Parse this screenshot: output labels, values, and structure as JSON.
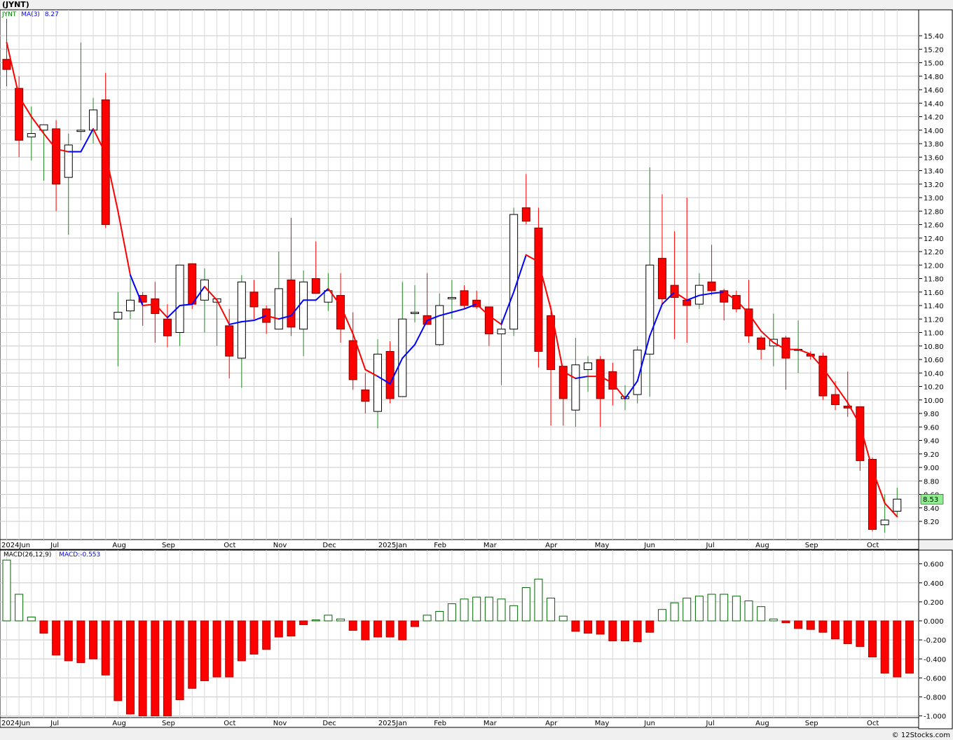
{
  "title": "(JYNT)",
  "credit": "© 12Stocks.com",
  "price_legend": {
    "symbol": "JYNT",
    "ma_label": "MA(3)",
    "ma_value": "8.27"
  },
  "macd_legend": {
    "label": "MACD(26,12,9)",
    "value_label": "MACD:-0.553"
  },
  "last_price_label": "8.53",
  "colors": {
    "bear": "#ff0000",
    "bull_fill": "#ffffff",
    "bull_wick": "#228b22",
    "ma_down": "#ff0000",
    "ma_up": "#0000ff",
    "macd_pos": "#006400",
    "macd_neg": "#ff0000",
    "last_price_bg": "#90ee90"
  },
  "chart_data": [
    {
      "type": "candlestick",
      "interval": "weekly",
      "ylim": [
        8.0,
        15.6
      ],
      "yticks": [
        "15.40",
        "15.20",
        "15.00",
        "14.80",
        "14.60",
        "14.40",
        "14.20",
        "14.00",
        "13.80",
        "13.60",
        "13.40",
        "13.20",
        "13.00",
        "12.80",
        "12.60",
        "12.40",
        "12.20",
        "12.00",
        "11.80",
        "11.60",
        "11.40",
        "11.20",
        "11.00",
        "10.80",
        "10.60",
        "10.40",
        "10.20",
        "10.00",
        "9.80",
        "9.60",
        "9.40",
        "9.20",
        "9.00",
        "8.80",
        "8.60",
        "8.40",
        "8.20"
      ],
      "month_labels": [
        {
          "label": "2024Jun",
          "week": 0
        },
        {
          "label": "Jul",
          "week": 4
        },
        {
          "label": "Aug",
          "week": 9
        },
        {
          "label": "Sep",
          "week": 13
        },
        {
          "label": "Oct",
          "week": 18
        },
        {
          "label": "Nov",
          "week": 22
        },
        {
          "label": "Dec",
          "week": 26
        },
        {
          "label": "2025Jan",
          "week": 30.5
        },
        {
          "label": "Feb",
          "week": 35
        },
        {
          "label": "Mar",
          "week": 39
        },
        {
          "label": "Apr",
          "week": 44
        },
        {
          "label": "May",
          "week": 48
        },
        {
          "label": "Jun",
          "week": 52
        },
        {
          "label": "Jul",
          "week": 57
        },
        {
          "label": "Aug",
          "week": 61
        },
        {
          "label": "Sep",
          "week": 65
        },
        {
          "label": "Oct",
          "week": 70
        }
      ],
      "ohlc": [
        [
          15.05,
          15.65,
          14.65,
          14.9
        ],
        [
          14.62,
          14.8,
          13.6,
          13.85
        ],
        [
          13.9,
          14.35,
          13.55,
          13.95
        ],
        [
          14.0,
          14.05,
          13.25,
          14.08
        ],
        [
          14.02,
          14.15,
          12.8,
          13.2
        ],
        [
          13.3,
          13.95,
          12.45,
          13.78
        ],
        [
          13.98,
          15.3,
          13.85,
          14.0
        ],
        [
          14.0,
          14.48,
          13.8,
          14.3
        ],
        [
          14.45,
          14.85,
          12.55,
          12.6
        ],
        [
          11.2,
          11.6,
          10.5,
          11.3
        ],
        [
          11.32,
          11.8,
          11.2,
          11.48
        ],
        [
          11.55,
          11.6,
          11.1,
          11.45
        ],
        [
          11.5,
          11.75,
          10.85,
          11.28
        ],
        [
          11.2,
          11.42,
          10.78,
          10.95
        ],
        [
          11.0,
          12.0,
          10.8,
          12.0
        ],
        [
          12.02,
          12.02,
          11.35,
          11.42
        ],
        [
          11.48,
          11.95,
          11.0,
          11.78
        ],
        [
          11.45,
          11.5,
          10.8,
          11.5
        ],
        [
          11.1,
          11.35,
          10.32,
          10.65
        ],
        [
          10.62,
          11.85,
          10.18,
          11.75
        ],
        [
          11.6,
          11.78,
          11.2,
          11.38
        ],
        [
          11.35,
          11.4,
          10.98,
          11.15
        ],
        [
          11.05,
          12.2,
          11.05,
          11.65
        ],
        [
          11.78,
          12.7,
          10.95,
          11.08
        ],
        [
          11.05,
          11.92,
          10.65,
          11.75
        ],
        [
          11.8,
          12.35,
          11.58,
          11.58
        ],
        [
          11.45,
          11.88,
          11.32,
          11.62
        ],
        [
          11.55,
          11.88,
          10.85,
          11.05
        ],
        [
          10.88,
          11.3,
          10.15,
          10.3
        ],
        [
          10.15,
          10.4,
          9.8,
          9.98
        ],
        [
          9.83,
          10.9,
          9.58,
          10.68
        ],
        [
          10.72,
          10.87,
          9.95,
          10.02
        ],
        [
          10.05,
          11.75,
          10.05,
          11.2
        ],
        [
          11.28,
          11.7,
          11.15,
          11.3
        ],
        [
          11.25,
          11.88,
          11.2,
          11.12
        ],
        [
          10.82,
          11.58,
          10.8,
          11.4
        ],
        [
          11.5,
          11.78,
          11.2,
          11.52
        ],
        [
          11.62,
          11.7,
          11.35,
          11.4
        ],
        [
          11.48,
          11.62,
          11.35,
          11.38
        ],
        [
          11.38,
          11.38,
          10.8,
          10.98
        ],
        [
          10.98,
          11.2,
          10.22,
          11.05
        ],
        [
          11.05,
          12.85,
          10.95,
          12.75
        ],
        [
          12.85,
          13.35,
          12.6,
          12.65
        ],
        [
          12.55,
          12.85,
          10.48,
          10.72
        ],
        [
          11.25,
          11.4,
          9.62,
          10.45
        ],
        [
          10.5,
          10.5,
          9.62,
          10.02
        ],
        [
          9.85,
          10.92,
          9.6,
          10.52
        ],
        [
          10.45,
          10.65,
          10.12,
          10.55
        ],
        [
          10.6,
          10.65,
          9.6,
          10.02
        ],
        [
          10.42,
          10.55,
          9.92,
          10.16
        ],
        [
          10.02,
          10.22,
          9.85,
          10.05
        ],
        [
          10.08,
          10.8,
          9.95,
          10.74
        ],
        [
          10.68,
          13.45,
          10.05,
          12.0
        ],
        [
          12.1,
          13.05,
          11.4,
          11.5
        ],
        [
          11.7,
          12.5,
          10.9,
          11.52
        ],
        [
          11.48,
          13.0,
          10.85,
          11.4
        ],
        [
          11.42,
          11.88,
          11.35,
          11.7
        ],
        [
          11.75,
          12.3,
          11.55,
          11.62
        ],
        [
          11.62,
          11.65,
          11.18,
          11.45
        ],
        [
          11.55,
          11.62,
          11.3,
          11.35
        ],
        [
          11.35,
          11.78,
          10.85,
          10.95
        ],
        [
          10.92,
          10.95,
          10.6,
          10.75
        ],
        [
          10.8,
          11.28,
          10.5,
          10.9
        ],
        [
          10.92,
          10.95,
          10.15,
          10.62
        ],
        [
          10.75,
          11.18,
          10.4,
          10.75
        ],
        [
          10.68,
          10.72,
          10.6,
          10.65
        ],
        [
          10.65,
          10.7,
          10.0,
          10.06
        ],
        [
          10.08,
          10.28,
          9.85,
          9.93
        ],
        [
          9.91,
          10.42,
          9.75,
          9.88
        ],
        [
          9.9,
          9.9,
          8.95,
          9.1
        ],
        [
          9.12,
          9.15,
          8.05,
          8.08
        ],
        [
          8.15,
          8.6,
          8.03,
          8.22
        ],
        [
          8.35,
          8.7,
          8.28,
          8.53
        ]
      ],
      "ma3": [
        15.3,
        14.5,
        14.2,
        13.95,
        13.72,
        13.68,
        13.68,
        14.02,
        13.65,
        12.8,
        11.85,
        11.4,
        11.42,
        11.22,
        11.4,
        11.42,
        11.68,
        11.48,
        11.12,
        11.16,
        11.18,
        11.25,
        11.2,
        11.25,
        11.48,
        11.48,
        11.65,
        11.4,
        10.98,
        10.45,
        10.35,
        10.24,
        10.62,
        10.82,
        11.18,
        11.25,
        11.3,
        11.35,
        11.42,
        11.25,
        11.12,
        11.6,
        12.15,
        12.05,
        11.35,
        10.42,
        10.32,
        10.35,
        10.35,
        10.25,
        10.02,
        10.28,
        10.95,
        11.42,
        11.6,
        11.48,
        11.55,
        11.58,
        11.6,
        11.48,
        11.28,
        11.02,
        10.85,
        10.75,
        10.75,
        10.68,
        10.47,
        10.22,
        9.96,
        9.63,
        8.97,
        8.47,
        8.27
      ],
      "ma3_colors": [
        "down",
        "down",
        "down",
        "down",
        "down",
        "down",
        "up",
        "up",
        "down",
        "down",
        "down",
        "up",
        "down",
        "down",
        "up",
        "up",
        "up",
        "down",
        "down",
        "up",
        "up",
        "up",
        "down",
        "up",
        "up",
        "up",
        "up",
        "down",
        "down",
        "down",
        "down",
        "up",
        "up",
        "up",
        "up",
        "up",
        "up",
        "up",
        "up",
        "down",
        "down",
        "up",
        "up",
        "down",
        "down",
        "down",
        "down",
        "up",
        "down",
        "down",
        "down",
        "up",
        "up",
        "up",
        "up",
        "down",
        "up",
        "up",
        "up",
        "down",
        "down",
        "down",
        "down",
        "down",
        "down",
        "down",
        "down",
        "down",
        "down",
        "down",
        "down",
        "down",
        "down"
      ],
      "last_price": 8.53
    },
    {
      "type": "bar",
      "name": "MACD(26,12,9)",
      "ylim": [
        -1.0,
        0.65
      ],
      "yticks": [
        "0.600",
        "0.400",
        "0.200",
        "0.000",
        "-0.200",
        "-0.400",
        "-0.600",
        "-0.800",
        "-1.000"
      ],
      "values": [
        0.64,
        0.28,
        0.04,
        -0.13,
        -0.36,
        -0.42,
        -0.44,
        -0.4,
        -0.57,
        -0.84,
        -0.98,
        -1.0,
        -1.0,
        -1.0,
        -0.83,
        -0.71,
        -0.63,
        -0.59,
        -0.59,
        -0.42,
        -0.35,
        -0.3,
        -0.17,
        -0.16,
        -0.04,
        0.01,
        0.06,
        0.02,
        -0.1,
        -0.2,
        -0.17,
        -0.17,
        -0.2,
        -0.06,
        0.06,
        0.1,
        0.18,
        0.23,
        0.25,
        0.25,
        0.23,
        0.16,
        0.35,
        0.44,
        0.24,
        0.05,
        -0.11,
        -0.13,
        -0.14,
        -0.21,
        -0.21,
        -0.22,
        -0.12,
        0.12,
        0.19,
        0.24,
        0.26,
        0.28,
        0.28,
        0.26,
        0.21,
        0.15,
        0.02,
        -0.02,
        -0.08,
        -0.09,
        -0.12,
        -0.19,
        -0.24,
        -0.27,
        -0.38,
        -0.55,
        -0.59,
        -0.55
      ],
      "last_value": -0.553
    }
  ]
}
